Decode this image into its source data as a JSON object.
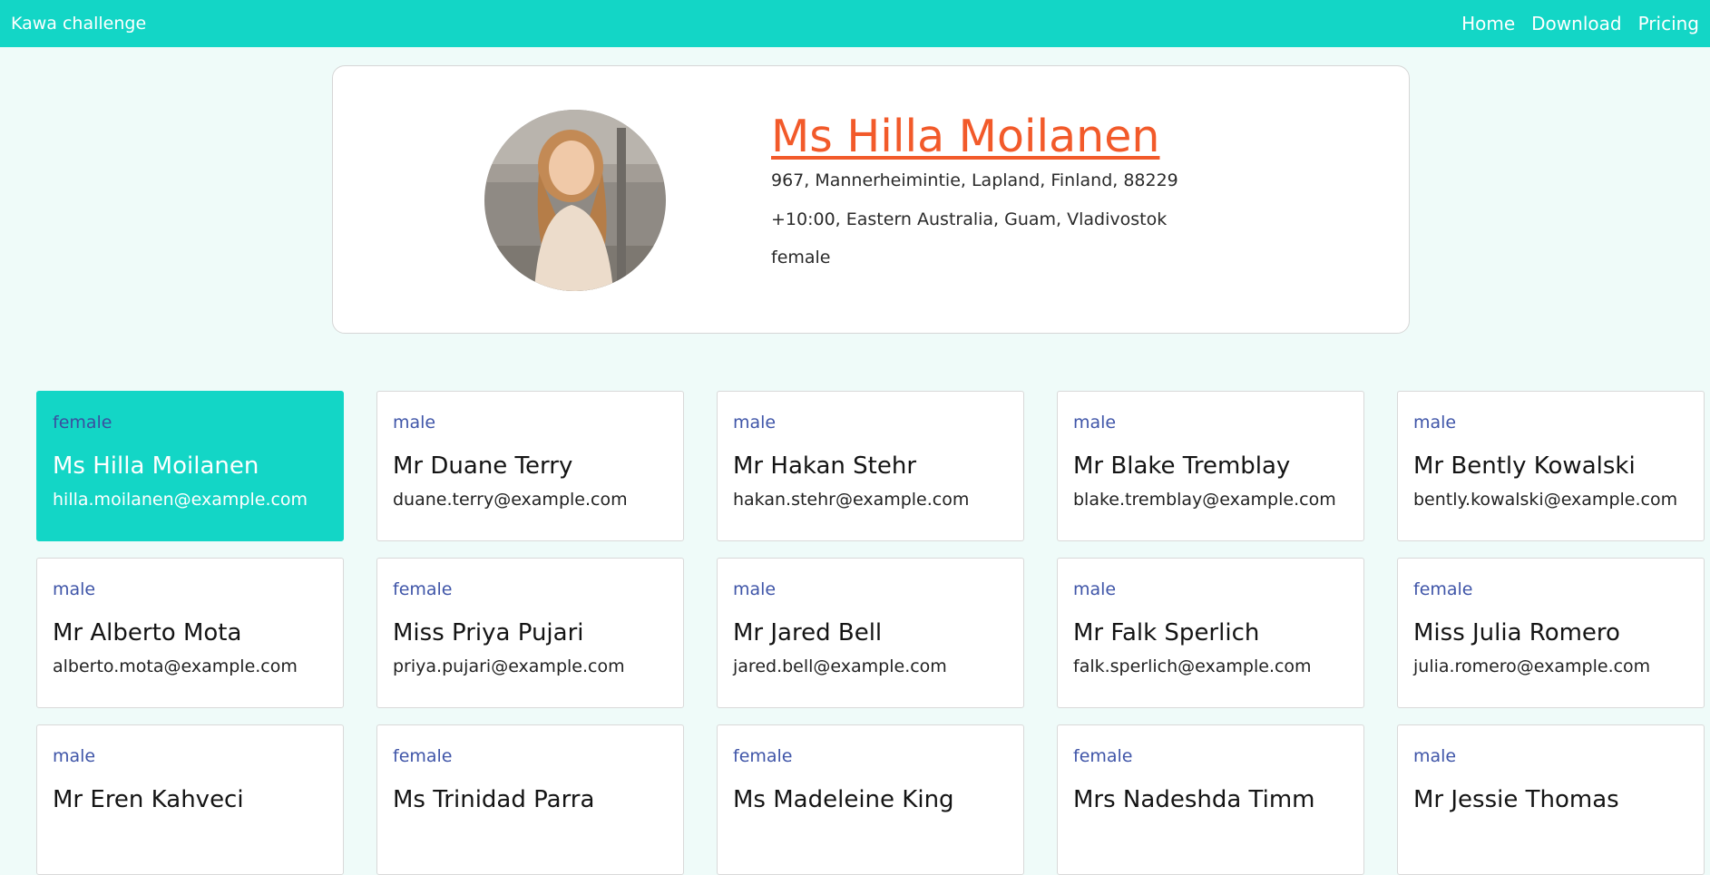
{
  "navbar": {
    "brand": "Kawa challenge",
    "links": [
      "Home",
      "Download",
      "Pricing"
    ]
  },
  "profile": {
    "name": "Ms Hilla Moilanen",
    "address": "967, Mannerheimintie, Lapland, Finland, 88229",
    "timezone": "+10:00, Eastern Australia, Guam, Vladivostok",
    "gender": "female"
  },
  "cards": [
    {
      "gender": "female",
      "name": "Ms Hilla Moilanen",
      "email": "hilla.moilanen@example.com",
      "active": true
    },
    {
      "gender": "male",
      "name": "Mr Duane Terry",
      "email": "duane.terry@example.com"
    },
    {
      "gender": "male",
      "name": "Mr Hakan Stehr",
      "email": "hakan.stehr@example.com"
    },
    {
      "gender": "male",
      "name": "Mr Blake Tremblay",
      "email": "blake.tremblay@example.com"
    },
    {
      "gender": "male",
      "name": "Mr Bently Kowalski",
      "email": "bently.kowalski@example.com"
    },
    {
      "gender": "male",
      "name": "Mr Alberto Mota",
      "email": "alberto.mota@example.com"
    },
    {
      "gender": "female",
      "name": "Miss Priya Pujari",
      "email": "priya.pujari@example.com"
    },
    {
      "gender": "male",
      "name": "Mr Jared Bell",
      "email": "jared.bell@example.com"
    },
    {
      "gender": "male",
      "name": "Mr Falk Sperlich",
      "email": "falk.sperlich@example.com"
    },
    {
      "gender": "female",
      "name": "Miss Julia Romero",
      "email": "julia.romero@example.com"
    },
    {
      "gender": "male",
      "name": "Mr Eren Kahveci",
      "email": ""
    },
    {
      "gender": "female",
      "name": "Ms Trinidad Parra",
      "email": ""
    },
    {
      "gender": "female",
      "name": "Ms Madeleine King",
      "email": ""
    },
    {
      "gender": "female",
      "name": "Mrs Nadeshda Timm",
      "email": ""
    },
    {
      "gender": "male",
      "name": "Mr Jessie Thomas",
      "email": ""
    }
  ]
}
